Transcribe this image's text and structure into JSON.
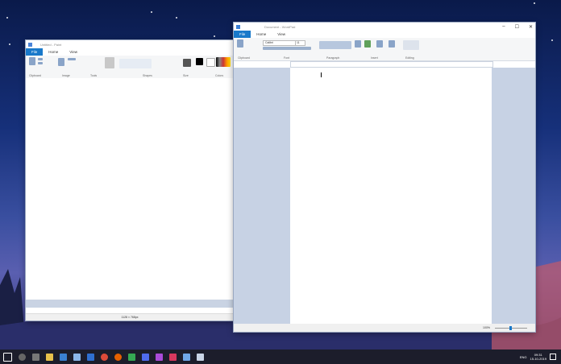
{
  "paint": {
    "title": "Untitled - Paint",
    "tabs": [
      "File",
      "Home",
      "View"
    ],
    "groups": [
      "Clipboard",
      "Image",
      "Tools",
      "Shapes",
      "Size",
      "Colors"
    ],
    "status_size": "1128 × 768px"
  },
  "wordpad": {
    "title": "Document - WordPad",
    "tabs": [
      "File",
      "Home",
      "View"
    ],
    "groups": [
      "Clipboard",
      "Font",
      "Paragraph",
      "Insert",
      "Editing"
    ],
    "font_name": "Calibri",
    "font_size": "11",
    "zoom": "100%"
  },
  "taskbar": {
    "time": "09:31",
    "date": "15-10-2019",
    "lang": "ENG"
  },
  "colors": {
    "file_tab": "#1979ca",
    "taskbar": "#1c1d2b"
  }
}
